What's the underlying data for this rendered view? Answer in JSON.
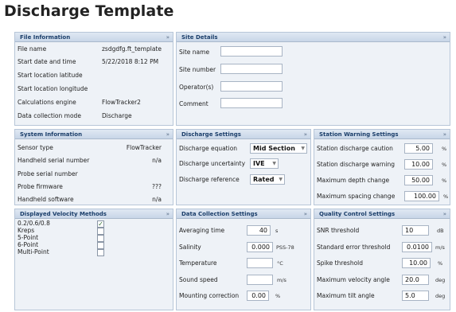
{
  "page": {
    "title": "Discharge Template"
  },
  "collapse_glyph": "»",
  "file_info": {
    "header": "File Information",
    "rows": [
      {
        "label": "File name",
        "value": "zsdgdfg.ft_template"
      },
      {
        "label": "Start date and time",
        "value": "5/22/2018 8:12 PM"
      },
      {
        "label": "Start location latitude",
        "value": ""
      },
      {
        "label": "Start location longitude",
        "value": ""
      },
      {
        "label": "Calculations engine",
        "value": "FlowTracker2"
      },
      {
        "label": "Data collection mode",
        "value": "Discharge"
      }
    ]
  },
  "site_details": {
    "header": "Site Details",
    "fields": [
      {
        "label": "Site name",
        "value": ""
      },
      {
        "label": "Site number",
        "value": ""
      },
      {
        "label": "Operator(s)",
        "value": ""
      },
      {
        "label": "Comment",
        "value": ""
      }
    ]
  },
  "system_info": {
    "header": "System Information",
    "rows": [
      {
        "label": "Sensor type",
        "value": "FlowTracker"
      },
      {
        "label": "Handheld serial number",
        "value": "n/a"
      },
      {
        "label": "Probe serial number",
        "value": ""
      },
      {
        "label": "Probe firmware",
        "value": "???"
      },
      {
        "label": "Handheld software",
        "value": "n/a"
      }
    ]
  },
  "discharge_settings": {
    "header": "Discharge Settings",
    "rows": [
      {
        "label": "Discharge equation",
        "value": "Mid Section"
      },
      {
        "label": "Discharge uncertainty",
        "value": "IVE"
      },
      {
        "label": "Discharge reference",
        "value": "Rated"
      }
    ]
  },
  "station_warning": {
    "header": "Station Warning Settings",
    "rows": [
      {
        "label": "Station discharge caution",
        "value": "5.00",
        "unit": "%"
      },
      {
        "label": "Station discharge warning",
        "value": "10.00",
        "unit": "%"
      },
      {
        "label": "Maximum depth change",
        "value": "50.00",
        "unit": "%"
      },
      {
        "label": "Maximum spacing change",
        "value": "100.00",
        "unit": "%"
      }
    ]
  },
  "velocity_methods": {
    "header": "Displayed Velocity Methods",
    "items": [
      {
        "label": "0.2/0.6/0.8",
        "checked": true
      },
      {
        "label": "Kreps",
        "checked": false
      },
      {
        "label": "5-Point",
        "checked": false
      },
      {
        "label": "6-Point",
        "checked": false
      },
      {
        "label": "Multi-Point",
        "checked": false
      }
    ]
  },
  "data_collection": {
    "header": "Data Collection Settings",
    "rows": [
      {
        "label": "Averaging time",
        "value": "40",
        "unit": "s"
      },
      {
        "label": "Salinity",
        "value": "0.000",
        "unit": "PSS-78"
      },
      {
        "label": "Temperature",
        "value": "",
        "unit": "°C"
      },
      {
        "label": "Sound speed",
        "value": "",
        "unit": "m/s"
      },
      {
        "label": "Mounting correction",
        "value": "0.00",
        "unit": "%"
      }
    ]
  },
  "quality_control": {
    "header": "Quality Control Settings",
    "rows": [
      {
        "label": "SNR threshold",
        "value": "10",
        "unit": "dB"
      },
      {
        "label": "Standard error threshold",
        "value": "0.0100",
        "unit": "m/s"
      },
      {
        "label": "Spike threshold",
        "value": "10.00",
        "unit": "%"
      },
      {
        "label": "Maximum velocity angle",
        "value": "20.0",
        "unit": "deg"
      },
      {
        "label": "Maximum tilt angle",
        "value": "5.0",
        "unit": "deg"
      }
    ]
  },
  "colors": {
    "panel_bg": "#eef2f7",
    "header_text": "#1b3e6a",
    "border": "#b7c6d8"
  }
}
